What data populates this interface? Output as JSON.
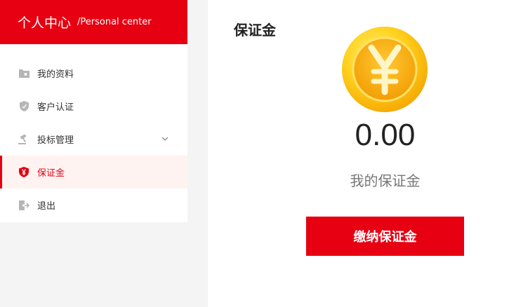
{
  "sidebar": {
    "title_cn": "个人中心",
    "title_en": "/Personal center",
    "items": [
      {
        "label": "我的资料",
        "icon": "folder-icon"
      },
      {
        "label": "客户认证",
        "icon": "shield-icon"
      },
      {
        "label": "投标管理",
        "icon": "gavel-icon",
        "has_submenu": true
      },
      {
        "label": "保证金",
        "icon": "yen-shield-icon",
        "active": true
      },
      {
        "label": "退出",
        "icon": "logout-icon"
      }
    ]
  },
  "main": {
    "title": "保证金",
    "coin_icon": "yen-coin-icon",
    "amount": "0.00",
    "amount_label": "我的保证金",
    "pay_button": "缴纳保证金"
  },
  "colors": {
    "accent": "#e60012",
    "active_bg": "#fff3f2",
    "coin": "#ffc61a"
  }
}
